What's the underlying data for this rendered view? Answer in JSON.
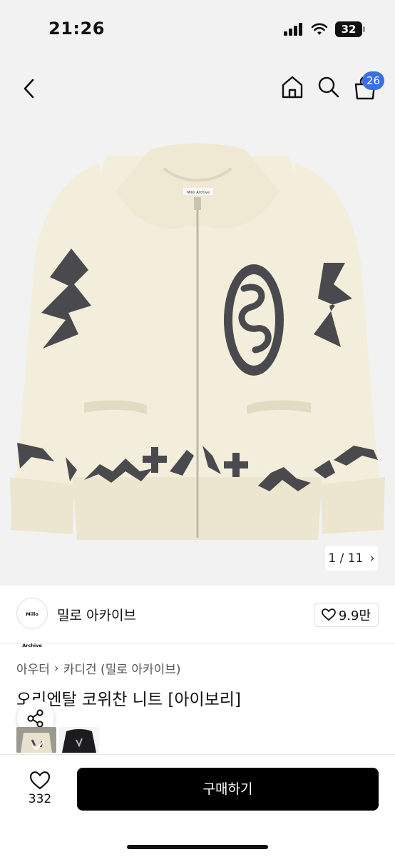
{
  "status": {
    "time": "21:26",
    "battery": "32"
  },
  "nav": {
    "cart_badge": "26"
  },
  "gallery": {
    "counter": "1 / 11",
    "brand_label": "Millo Archive"
  },
  "seller": {
    "avatar_text": "Millo Archive",
    "name": "밀로 아카이브",
    "likes": "9.9만"
  },
  "breadcrumb": {
    "level1": "아우터",
    "level2": "카디건 (밀로 아카이브)"
  },
  "product": {
    "title": "오리엔탈 코위찬 니트 [아이보리]"
  },
  "bottom": {
    "wish_count": "332",
    "buy_label": "구매하기"
  },
  "colors": {
    "accent": "#3b6fe6",
    "cardigan": "#f3eedb",
    "pattern": "#4a4a4e",
    "buy_button": "#000000"
  }
}
